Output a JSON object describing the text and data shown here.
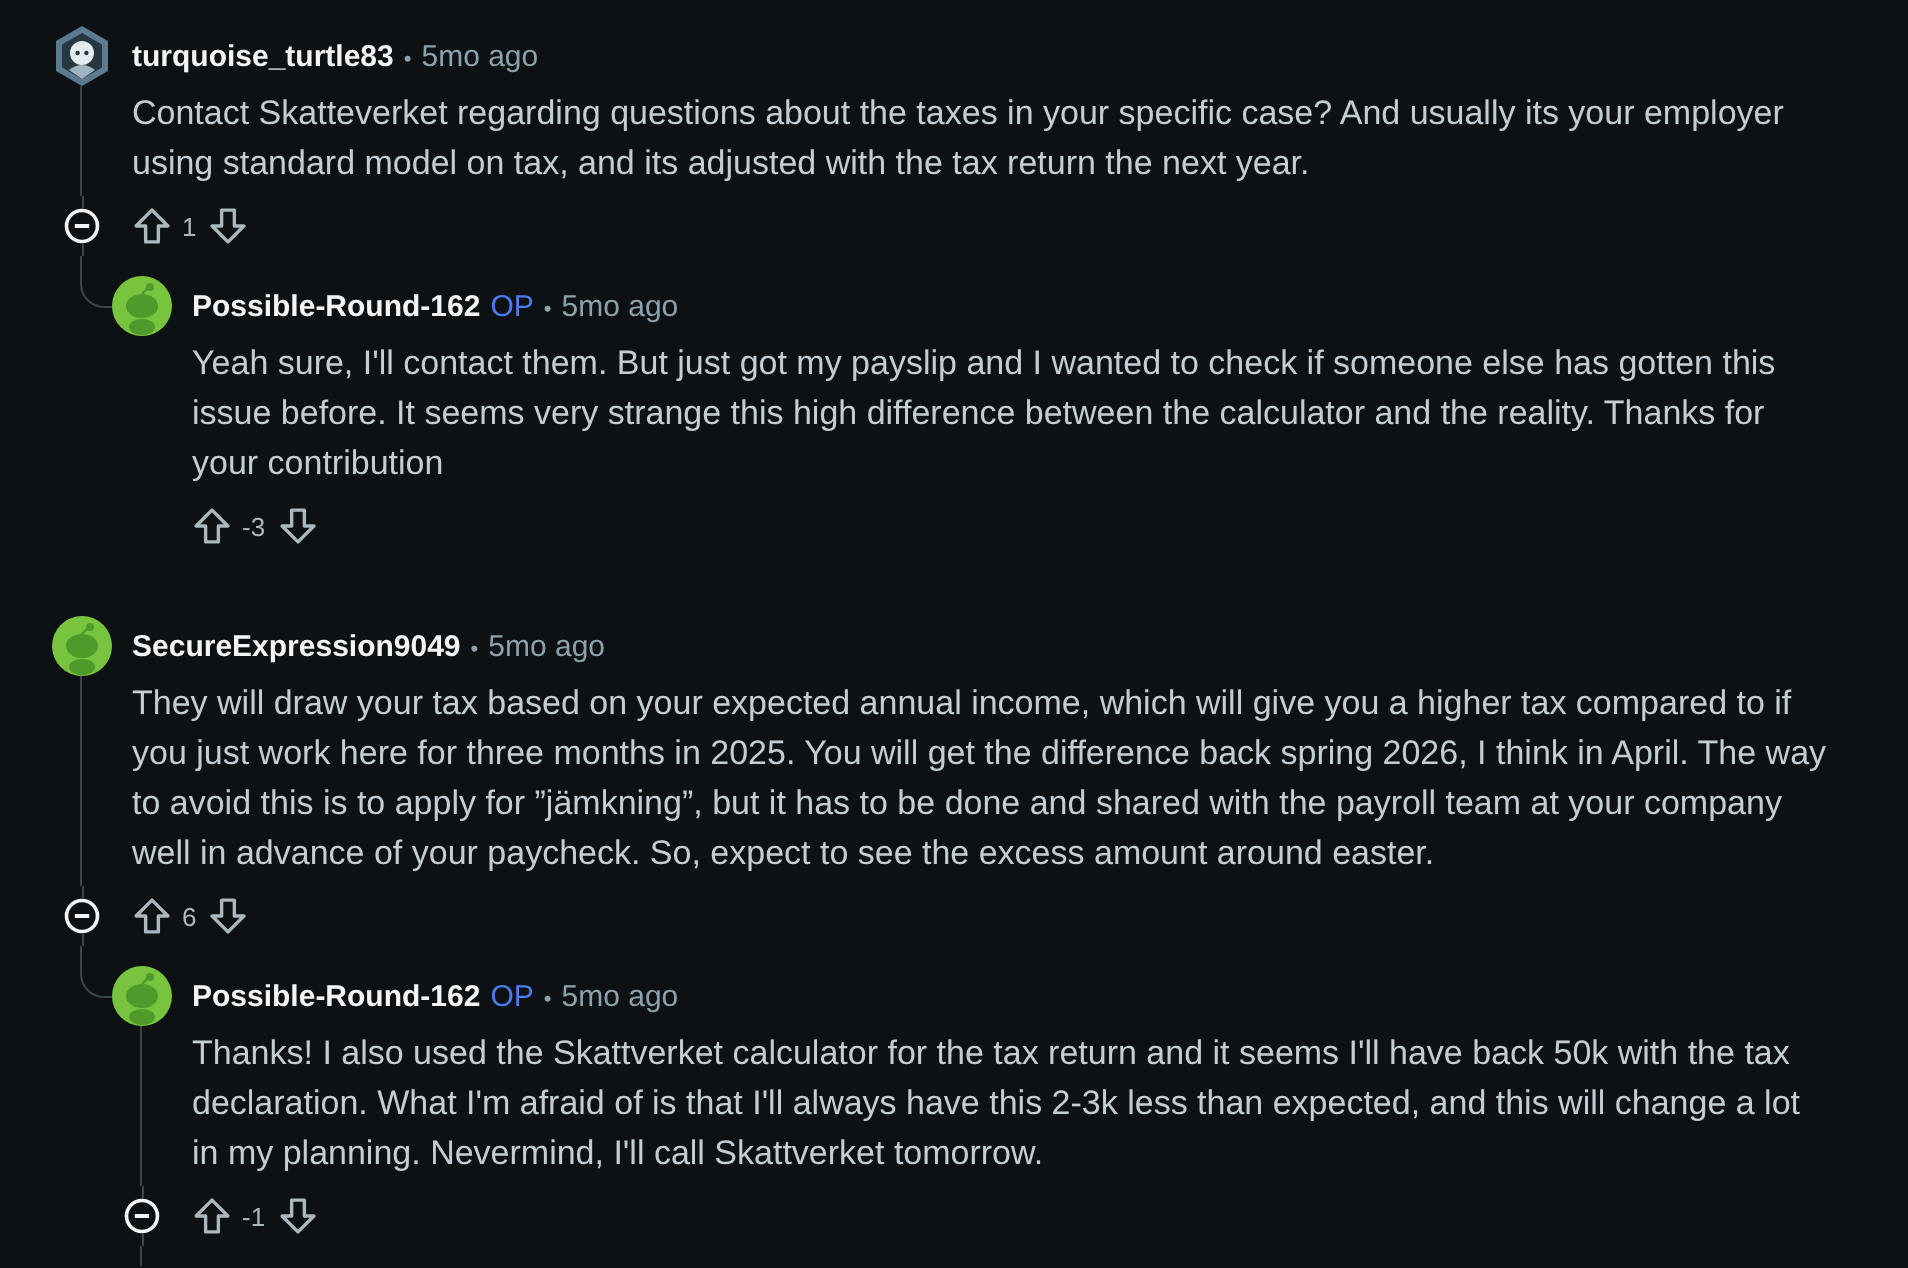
{
  "comments": [
    {
      "author": "turquoise_turtle83",
      "avatar": {
        "kind": "custom"
      },
      "separator": "•",
      "time": "5mo ago",
      "body": "Contact Skatteverket regarding questions about the taxes in your specific case? And usually its your employer using standard model on tax, and its adjusted with the tax return the next year.",
      "score": "1",
      "collapse_toggle": true,
      "replies": [
        {
          "author": "Possible-Round-162",
          "avatar": {
            "kind": "snoo"
          },
          "badge": "OP",
          "separator": "•",
          "time": "5mo ago",
          "body": "Yeah sure, I'll contact them. But just got my payslip and I wanted to check if someone else has gotten this issue before. It seems very strange this high difference between the calculator and the reality. Thanks for your contribution",
          "score": "-3",
          "collapse_toggle": false
        }
      ]
    },
    {
      "author": "SecureExpression9049",
      "avatar": {
        "kind": "snoo"
      },
      "separator": "•",
      "time": "5mo ago",
      "body": "They will draw your tax based on your expected annual income, which will give you a higher tax compared to if you just work here for three months in 2025. You will get the difference back spring 2026, I think in April. The way to avoid this is to apply for ”jämkning”, but it has to be done and shared with the payroll team at your company well in advance of your paycheck. So, expect to see the excess amount around easter.",
      "score": "6",
      "collapse_toggle": true,
      "replies": [
        {
          "author": "Possible-Round-162",
          "avatar": {
            "kind": "snoo"
          },
          "badge": "OP",
          "separator": "•",
          "time": "5mo ago",
          "body": "Thanks! I also used the Skattverket calculator for the tax return and it seems I'll have back 50k with the tax declaration. What I'm afraid of is that I'll always have this 2-3k less than expected, and this will change a lot in my planning. Nevermind, I'll call Skattverket tomorrow.",
          "score": "-1",
          "collapse_toggle": true
        }
      ]
    }
  ]
}
